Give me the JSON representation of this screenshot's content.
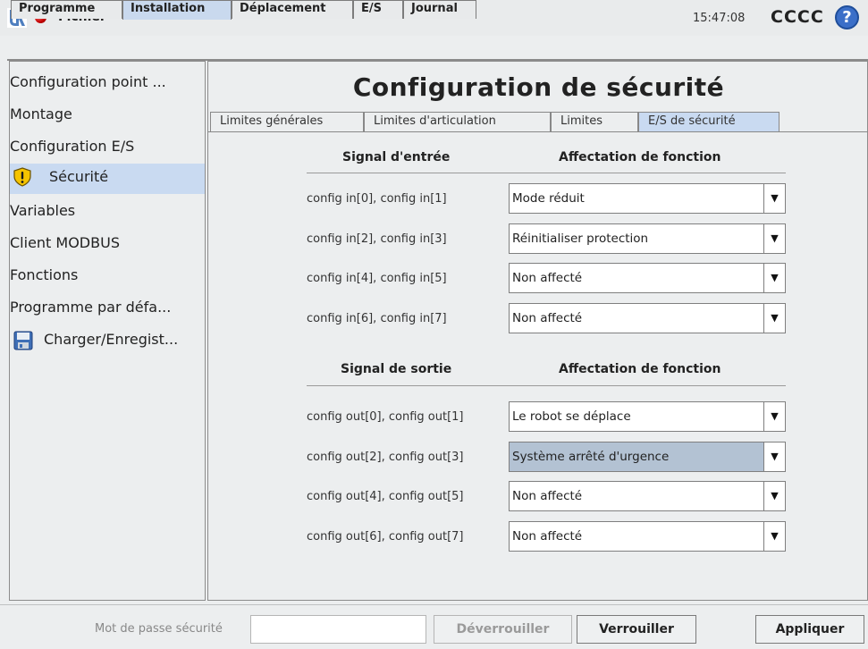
{
  "header": {
    "app_title": "Fichier",
    "clock": "15:47:08",
    "robot_name": "CCCC",
    "help_label": "?"
  },
  "main_tabs": [
    {
      "label": "Programme",
      "active": false
    },
    {
      "label": "Installation",
      "active": true
    },
    {
      "label": "Déplacement",
      "active": false
    },
    {
      "label": "E/S",
      "active": false
    },
    {
      "label": "Journal",
      "active": false
    }
  ],
  "sidebar": {
    "items": [
      {
        "label": "Configuration point ...",
        "icon": "",
        "active": false
      },
      {
        "label": "Montage",
        "icon": "",
        "active": false
      },
      {
        "label": "Configuration E/S",
        "icon": "",
        "active": false
      },
      {
        "label": "Sécurité",
        "icon": "warning-shield-icon",
        "active": true
      },
      {
        "label": "Variables",
        "icon": "",
        "active": false
      },
      {
        "label": "Client MODBUS",
        "icon": "",
        "active": false
      },
      {
        "label": "Fonctions",
        "icon": "",
        "active": false
      },
      {
        "label": "Programme par défa...",
        "icon": "",
        "active": false
      },
      {
        "label": "Charger/Enregist...",
        "icon": "floppy-disk-icon",
        "active": false
      }
    ]
  },
  "main": {
    "title": "Configuration de sécurité",
    "sub_tabs": [
      {
        "label": "Limites générales",
        "active": false
      },
      {
        "label": "Limites d'articulation",
        "active": false
      },
      {
        "label": "Limites",
        "active": false
      },
      {
        "label": "E/S de sécurité",
        "active": true
      }
    ],
    "inputs": {
      "signal_header": "Signal d'entrée",
      "function_header": "Affectation de fonction",
      "rows": [
        {
          "signal": "config in[0], config in[1]",
          "value": "Mode réduit"
        },
        {
          "signal": "config in[2], config in[3]",
          "value": "Réinitialiser protection"
        },
        {
          "signal": "config in[4], config in[5]",
          "value": "Non affecté"
        },
        {
          "signal": "config in[6], config in[7]",
          "value": "Non affecté"
        }
      ]
    },
    "outputs": {
      "signal_header": "Signal de sortie",
      "function_header": "Affectation de fonction",
      "rows": [
        {
          "signal": "config out[0], config out[1]",
          "value": "Le robot se déplace"
        },
        {
          "signal": "config out[2], config out[3]",
          "value": "Système arrêté d'urgence"
        },
        {
          "signal": "config out[4], config out[5]",
          "value": "Non affecté"
        },
        {
          "signal": "config out[6], config out[7]",
          "value": "Non affecté"
        }
      ]
    }
  },
  "footer": {
    "password_label": "Mot de passe sécurité",
    "password_value": "",
    "unlock_label": "Déverrouiller",
    "lock_label": "Verrouiller",
    "apply_label": "Appliquer"
  },
  "colors": {
    "accent_selected": "#c9daf1",
    "dropdown_selected": "#b3c2d3",
    "status_dot": "#d00000",
    "help_icon": "#3b6fc8"
  }
}
